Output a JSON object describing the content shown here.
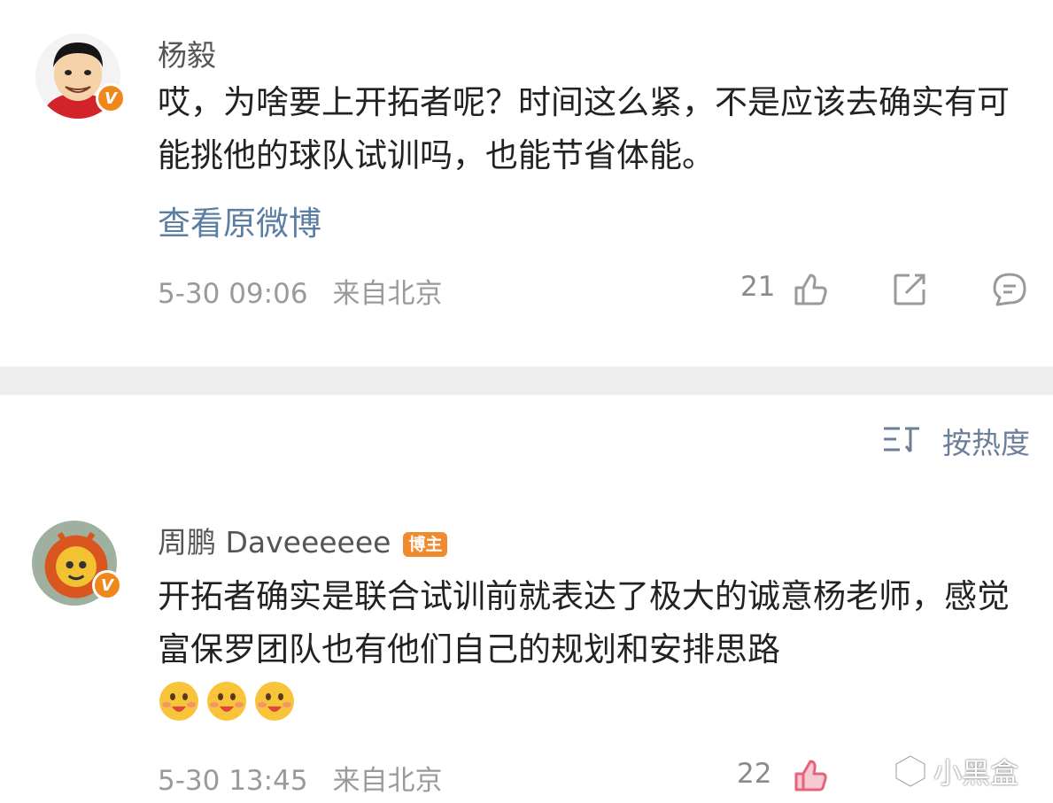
{
  "post1": {
    "username": "杨毅",
    "content": "哎，为啥要上开拓者呢？时间这么紧，不是应该去确实有可能挑他的球队试训吗，也能节省体能。",
    "view_link": "查看原微博",
    "date": "5-30 09:06",
    "location": "来自北京",
    "likes": "21",
    "verified": "V"
  },
  "sort": {
    "label": "按热度"
  },
  "post2": {
    "username": "周鹏 Daveeeeee",
    "badge": "博主",
    "content": "开拓者确实是联合试训前就表达了极大的诚意杨老师，感觉富保罗团队也有他们自己的规划和安排思路",
    "emoji": [
      "grin-emoji",
      "grin-emoji",
      "grin-emoji"
    ],
    "date": "5-30 13:45",
    "location": "来自北京",
    "likes": "22",
    "verified": "V"
  },
  "watermark": "小黑盒",
  "colors": {
    "link": "#5b7ea3",
    "badge": "#f08a2e",
    "liked": "#e5637a",
    "divider": "#eeeeee"
  }
}
